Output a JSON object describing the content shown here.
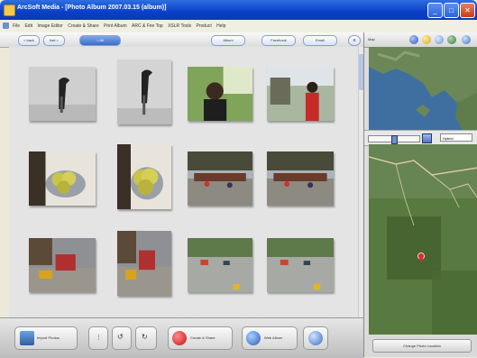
{
  "app": {
    "title": "ArcSoft Media - [Photo Album 2007.03.15 (album)]"
  },
  "menubar": {
    "items": [
      "File",
      "Edit",
      "Image Editor",
      "Create & Share",
      "Print Album",
      "ARC & Fire Top",
      "XSLR Tools",
      "Product",
      "Help"
    ]
  },
  "toolbar": {
    "back_label": "< back",
    "fwd_label": "fwd >",
    "tab_label": "< All",
    "tabs": [
      "Album",
      "Facebook",
      "Email"
    ]
  },
  "photos": [
    {
      "scene": "bird"
    },
    {
      "scene": "bird-tall"
    },
    {
      "scene": "person-green"
    },
    {
      "scene": "person-red"
    },
    {
      "scene": "bowl"
    },
    {
      "scene": "bowl"
    },
    {
      "scene": "street"
    },
    {
      "scene": "street"
    },
    {
      "scene": "street-gray"
    },
    {
      "scene": "street-gray"
    },
    {
      "scene": "road"
    },
    {
      "scene": "road"
    }
  ],
  "bottombar": {
    "import_label": "Import Photos",
    "create_label": "Create & Share",
    "web_label": "Web Album"
  },
  "map": {
    "header_label": "Map",
    "zoom_level": 0.5,
    "map_type": "Hybrid",
    "footer_label": "Change Photo Location",
    "colors": {
      "sea": "#3f6fa0",
      "land": "#6b8757",
      "forest": "#3f5c2a",
      "road": "#d9c9a0",
      "marker": "#e32b2b"
    }
  },
  "colors": {
    "titlebar": "#0a3fc8",
    "pane": "#e4e4e4",
    "accent": "#6b8fd6"
  }
}
